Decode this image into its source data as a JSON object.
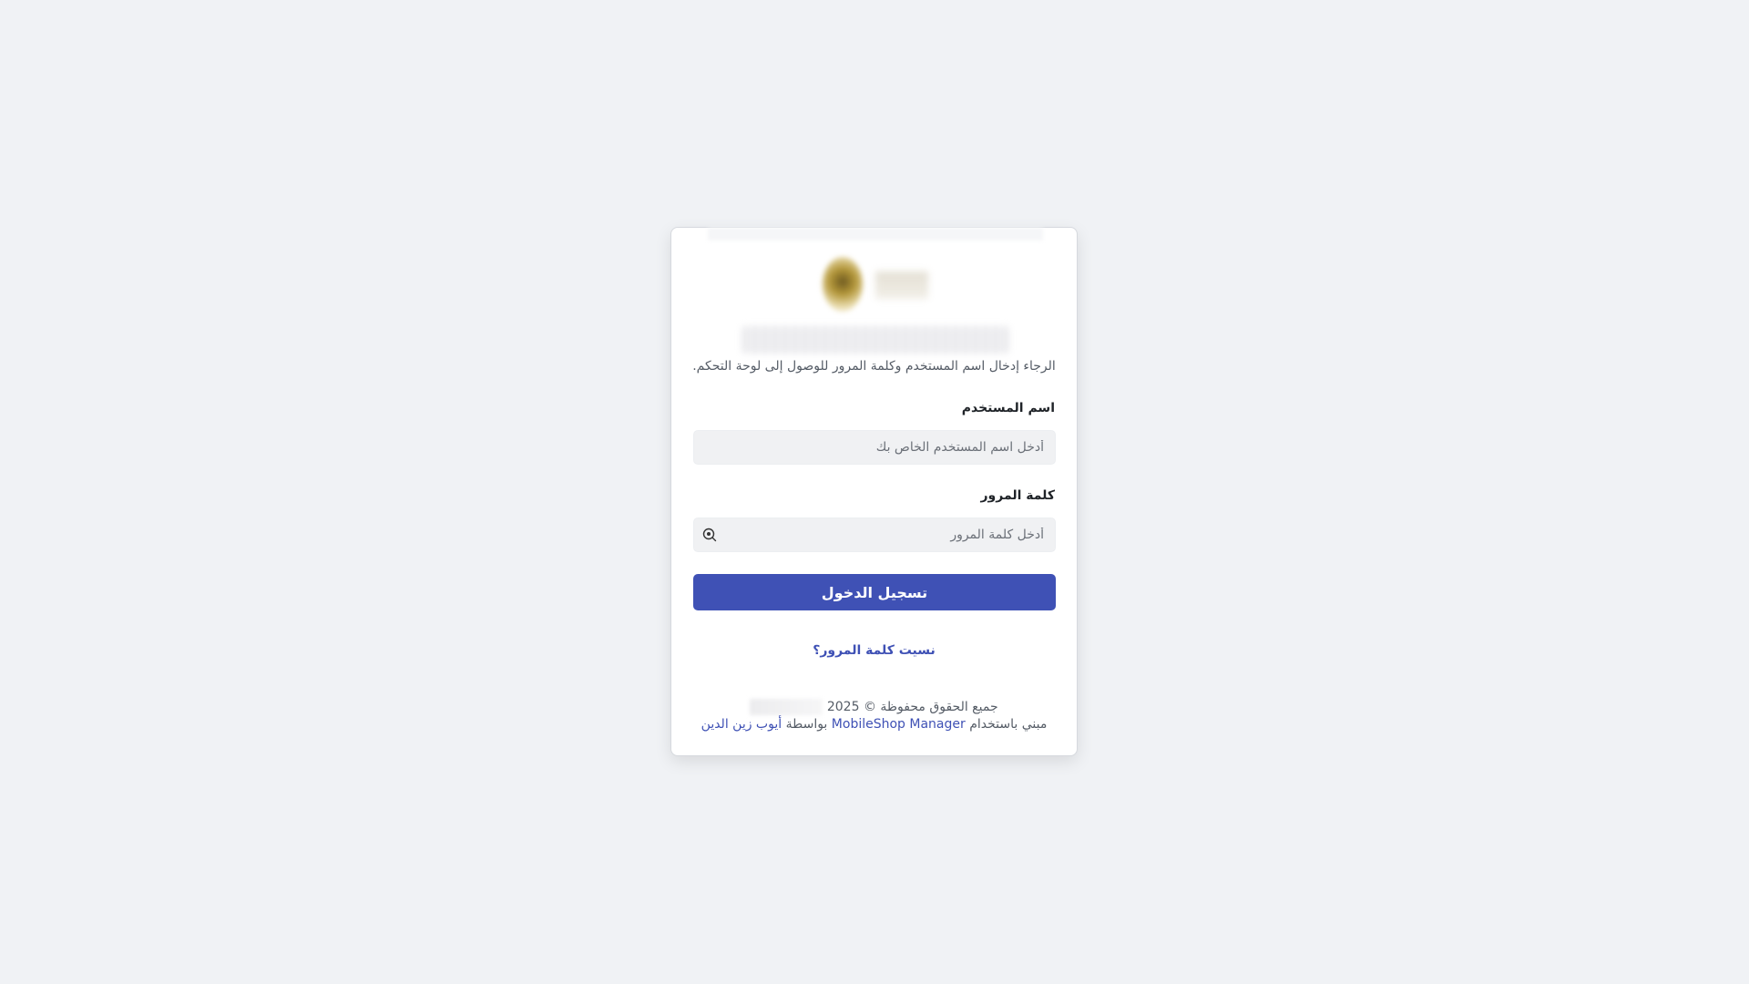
{
  "login": {
    "subtitle": "الرجاء إدخال اسم المستخدم وكلمة المرور للوصول إلى لوحة التحكم.",
    "username_label": "اسم المستخدم",
    "username_placeholder": "أدخل اسم المستخدم الخاص بك",
    "password_label": "كلمة المرور",
    "password_placeholder": "أدخل كلمة المرور",
    "password_toggle_icon": "eye-icon",
    "submit_label": "تسجيل الدخول",
    "forgot_password": "نسيت كلمة المرور؟"
  },
  "footer": {
    "rights": "جميع الحقوق محفوظة © 2025",
    "built_with_prefix": "مبني باستخدام",
    "product_link": "MobileShop Manager",
    "by_word": "بواسطة",
    "author_link": "أيوب زين الدين"
  },
  "colors": {
    "background": "#f0f2f5",
    "accent": "#3f51b5",
    "card": "#ffffff"
  }
}
